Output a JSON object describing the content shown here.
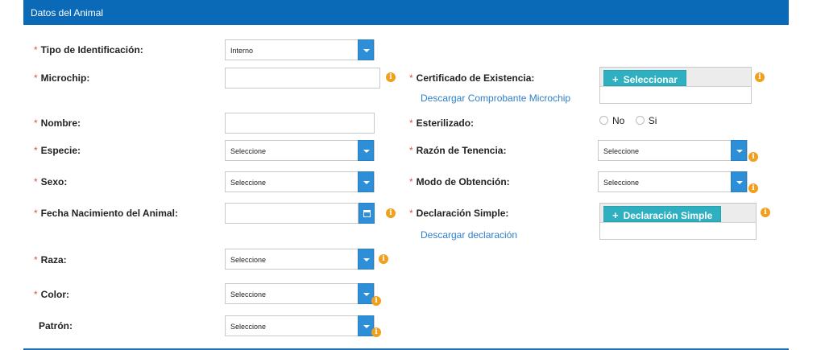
{
  "panel": {
    "title": "Datos del Animal"
  },
  "required_mark": "*",
  "info_glyph": "i",
  "upload_plus": "+",
  "left": {
    "tipo_id": {
      "label": "Tipo de Identificación:",
      "value": "Interno"
    },
    "microchip": {
      "label": "Microchip:",
      "value": ""
    },
    "nombre": {
      "label": "Nombre:",
      "value": ""
    },
    "especie": {
      "label": "Especie:",
      "value": "Seleccione"
    },
    "sexo": {
      "label": "Sexo:",
      "value": "Seleccione"
    },
    "fecha": {
      "label": "Fecha Nacimiento del Animal:",
      "value": ""
    },
    "raza": {
      "label": "Raza:",
      "value": "Seleccione"
    },
    "color": {
      "label": "Color:",
      "value": "Seleccione"
    },
    "patron": {
      "label": "Patrón:",
      "value": "Seleccione"
    }
  },
  "right": {
    "certificado": {
      "label": "Certificado de Existencia:",
      "button": "Seleccionar",
      "download_link": "Descargar Comprobante Microchip"
    },
    "esterilizado": {
      "label": "Esterilizado:",
      "options": [
        "No",
        "Si"
      ]
    },
    "razon": {
      "label": "Razón de Tenencia:",
      "value": "Seleccione"
    },
    "modo": {
      "label": "Modo de Obtención:",
      "value": "Seleccione"
    },
    "declaracion": {
      "label": "Declaración Simple:",
      "button": "Declaración Simple",
      "download_link": "Descargar declaración"
    }
  },
  "colors": {
    "header": "#0a6ab8",
    "select_arrow": "#2d8fd8",
    "info": "#f0a01c",
    "upload_button": "#2eb0c0",
    "link": "#2f7fc8",
    "required": "#d9534f"
  }
}
